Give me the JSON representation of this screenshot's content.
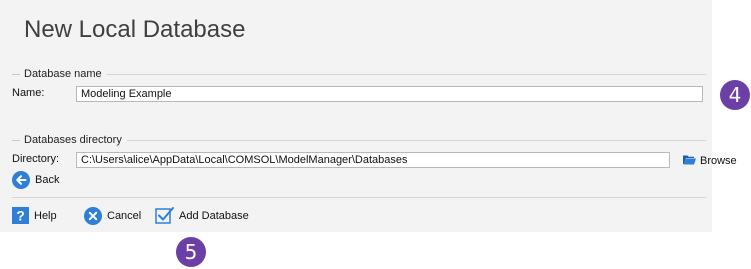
{
  "dialog": {
    "title": "New Local Database"
  },
  "database_name_group": {
    "legend": "Database name",
    "name_label": "Name:",
    "name_value": "Modeling Example"
  },
  "databases_directory_group": {
    "legend": "Databases directory",
    "directory_label": "Directory:",
    "directory_value": "C:\\Users\\alice\\AppData\\Local\\COMSOL\\ModelManager\\Databases",
    "browse_label": "Browse"
  },
  "navigation": {
    "back_label": "Back"
  },
  "footer": {
    "help_label": "Help",
    "cancel_label": "Cancel",
    "add_database_label": "Add Database"
  },
  "callouts": {
    "step_4": "4",
    "step_5": "5"
  },
  "colors": {
    "accent_blue": "#2f7fd8",
    "callout_purple": "#6b3fa5",
    "panel_background": "#f3f3f4"
  },
  "icons": [
    "folder-icon",
    "back-arrow-icon",
    "help-icon",
    "cancel-icon",
    "add-database-checkbox-icon"
  ]
}
